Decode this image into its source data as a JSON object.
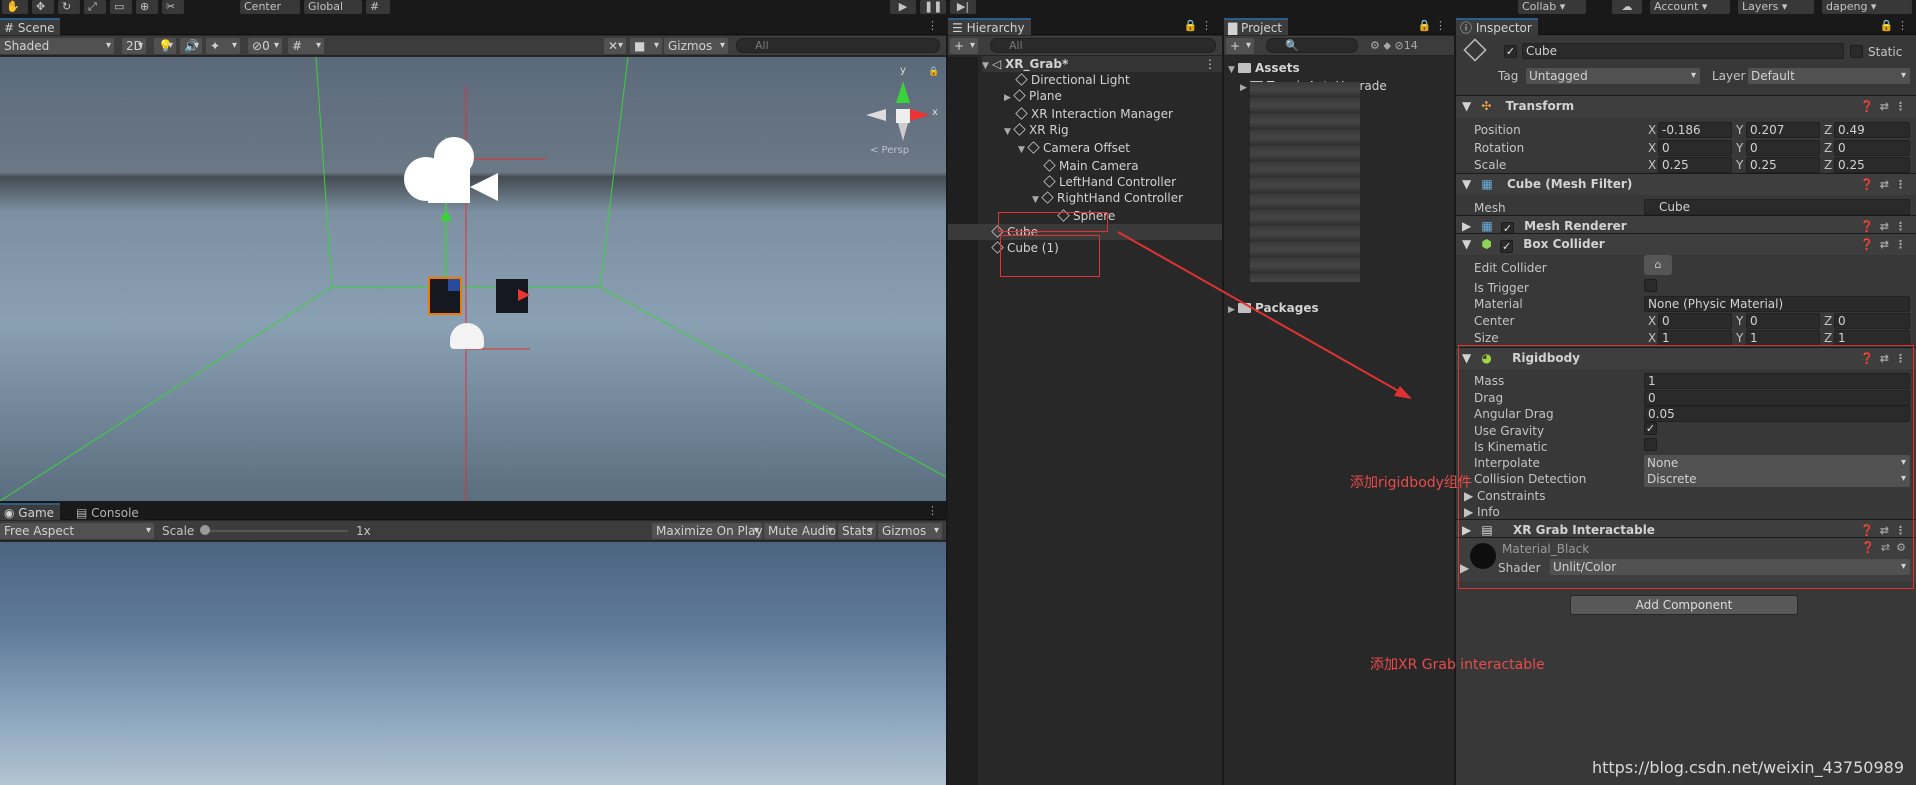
{
  "topbar": {
    "center_label": "Center",
    "global_label": "Global",
    "collab_label": "Collab",
    "account_label": "Account",
    "layers_label": "Layers",
    "user_label": "dapeng"
  },
  "scene": {
    "tab_label": "Scene",
    "shading_mode": "Shaded",
    "mode_2d": "2D",
    "hidden_count": "0",
    "gizmos_label": "Gizmos",
    "search_placeholder": "All",
    "persp_label": "< Persp"
  },
  "game": {
    "tab_label": "Game",
    "console_tab_label": "Console",
    "aspect": "Free Aspect",
    "scale_label": "Scale",
    "scale_value": "1x",
    "maximize_label": "Maximize On Play",
    "mute_label": "Mute Audio",
    "stats_label": "Stats",
    "gizmos_label": "Gizmos"
  },
  "hierarchy": {
    "tab_label": "Hierarchy",
    "search_placeholder": "All",
    "scene_name": "XR_Grab*",
    "items": [
      {
        "label": "Directional Light"
      },
      {
        "label": "Plane"
      },
      {
        "label": "XR Interaction Manager"
      },
      {
        "label": "XR Rig"
      },
      {
        "label": "Camera Offset"
      },
      {
        "label": "Main Camera"
      },
      {
        "label": "LeftHand Controller"
      },
      {
        "label": "RightHand Controller"
      },
      {
        "label": "Sphere"
      },
      {
        "label": "Cube"
      },
      {
        "label": "Cube (1)"
      }
    ]
  },
  "project": {
    "tab_label": "Project",
    "hidden_count": "14",
    "assets_label": "Assets",
    "first_folder": "TerrainAutoUpgrade",
    "packages_label": "Packages"
  },
  "inspector": {
    "tab_label": "Inspector",
    "object_name": "Cube",
    "static_label": "Static",
    "tag_label": "Tag",
    "tag_value": "Untagged",
    "layer_label": "Layer",
    "layer_value": "Default",
    "transform": {
      "title": "Transform",
      "position_label": "Position",
      "rotation_label": "Rotation",
      "scale_label": "Scale",
      "position": {
        "x": "-0.186",
        "y": "0.207",
        "z": "0.49"
      },
      "rotation": {
        "x": "0",
        "y": "0",
        "z": "0"
      },
      "scale": {
        "x": "0.25",
        "y": "0.25",
        "z": "0.25"
      }
    },
    "mesh_filter": {
      "title": "Cube (Mesh Filter)",
      "mesh_label": "Mesh",
      "mesh_value": "Cube"
    },
    "mesh_renderer": {
      "title": "Mesh Renderer"
    },
    "box_collider": {
      "title": "Box Collider",
      "edit_label": "Edit Collider",
      "trigger_label": "Is Trigger",
      "material_label": "Material",
      "material_value": "None (Physic Material)",
      "center_label": "Center",
      "center": {
        "x": "0",
        "y": "0",
        "z": "0"
      },
      "size_label": "Size",
      "size": {
        "x": "1",
        "y": "1",
        "z": "1"
      }
    },
    "rigidbody": {
      "title": "Rigidbody",
      "mass_label": "Mass",
      "mass": "1",
      "drag_label": "Drag",
      "drag": "0",
      "angular_drag_label": "Angular Drag",
      "angular_drag": "0.05",
      "gravity_label": "Use Gravity",
      "kinematic_label": "Is Kinematic",
      "interpolate_label": "Interpolate",
      "interpolate": "None",
      "collision_label": "Collision Detection",
      "collision": "Discrete",
      "constraints_label": "Constraints",
      "info_label": "Info"
    },
    "xr_grab": {
      "title": "XR Grab Interactable"
    },
    "material": {
      "name": "Material_Black",
      "shader_label": "Shader",
      "shader_value": "Unlit/Color"
    },
    "add_component_label": "Add Component"
  },
  "annotations": {
    "rigidbody_note": "添加rigidbody组件",
    "xr_grab_note": "添加XR Grab interactable"
  },
  "watermark": "https://blog.csdn.net/weixin_43750989",
  "colors": {
    "selection": "#2c5d87",
    "annotation": "#e03232",
    "accent_green": "#3bd13b"
  }
}
